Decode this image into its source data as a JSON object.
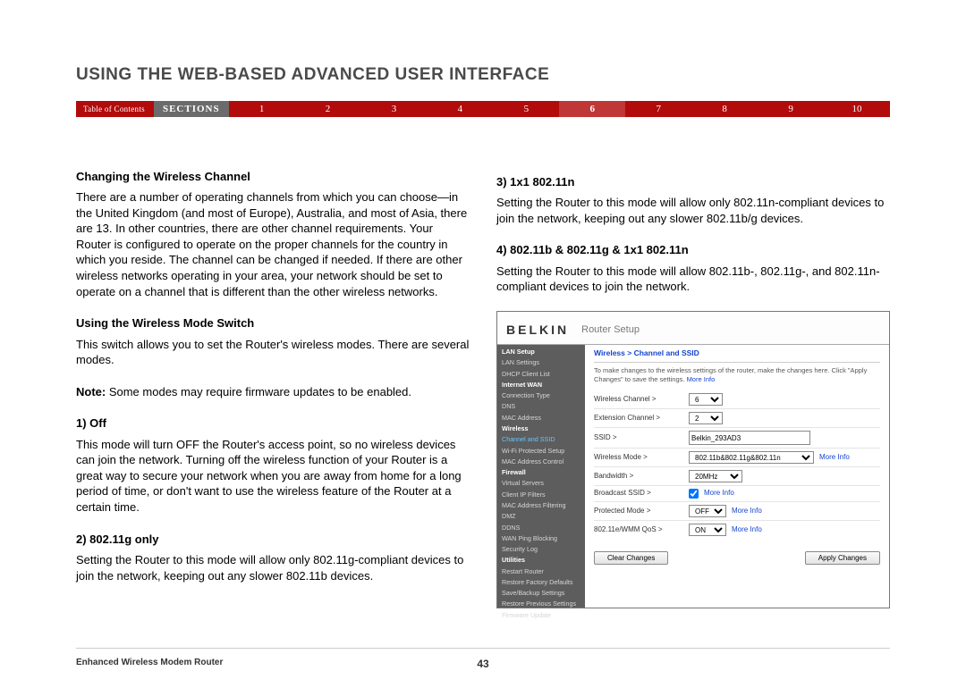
{
  "title": "USING THE WEB-BASED ADVANCED USER INTERFACE",
  "nav": {
    "toc": "Table of Contents",
    "sections": "SECTIONS",
    "nums": [
      "1",
      "2",
      "3",
      "4",
      "5",
      "6",
      "7",
      "8",
      "9",
      "10"
    ],
    "active": "6"
  },
  "left": {
    "h1": "Changing the Wireless Channel",
    "p1": "There are a number of operating channels from which you can choose—in the United Kingdom (and most of Europe), Australia, and most of Asia, there are 13. In other countries, there are other channel requirements. Your Router is configured to operate on the proper channels for the country in which you reside. The channel can be changed if needed. If there are other wireless networks operating in your area, your network should be set to operate on a channel that is different than the other wireless networks.",
    "h2": "Using the Wireless Mode Switch",
    "p2": "This switch allows you to set the Router's wireless modes. There are several modes.",
    "note_label": "Note:",
    "note_text": " Some modes may require firmware updates to be enabled.",
    "m1h": "1) Off",
    "m1p": "This mode will turn OFF the Router's access point, so no wireless devices can join the network. Turning off the wireless function of your Router is a great way to secure your network when you are away from home for a long period of time, or don't want to use the wireless feature of the Router at a certain time.",
    "m2h": "2) 802.11g only",
    "m2p": "Setting the Router to this mode will allow only 802.11g-compliant devices to join the network, keeping out any slower 802.11b devices."
  },
  "right": {
    "m3h": "3) 1x1 802.11n",
    "m3p": "Setting the Router to this mode will allow only 802.11n-compliant devices to join the network, keeping out any slower 802.11b/g devices.",
    "m4h": "4) 802.11b & 802.11g & 1x1 802.11n",
    "m4p": "Setting the Router to this mode will allow 802.11b-, 802.11g-, and 802.11n-compliant devices to join the network."
  },
  "router": {
    "brand": "BELKIN",
    "setup": "Router Setup",
    "breadcrumb": "Wireless > Channel and SSID",
    "note_text": "To make changes to the wireless settings of the router, make the changes here. Click \"Apply Changes\" to save the settings. ",
    "more_info": "More Info",
    "rows": {
      "ch_l": "Wireless Channel >",
      "ch_v": "6",
      "ex_l": "Extension Channel >",
      "ex_v": "2",
      "ss_l": "SSID >",
      "ss_v": "Belkin_293AD3",
      "wm_l": "Wireless Mode >",
      "wm_v": "802.11b&802.11g&802.11n",
      "bw_l": "Bandwidth >",
      "bw_v": "20MHz",
      "bs_l": "Broadcast SSID >",
      "pm_l": "Protected Mode >",
      "pm_v": "OFF",
      "qos_l": "802.11e/WMM QoS >",
      "qos_v": "ON"
    },
    "btn_clear": "Clear Changes",
    "btn_apply": "Apply Changes",
    "sidebar": [
      {
        "t": "LAN Setup",
        "c": "side-head"
      },
      {
        "t": "LAN Settings"
      },
      {
        "t": "DHCP Client List"
      },
      {
        "t": "Internet WAN",
        "c": "side-head"
      },
      {
        "t": "Connection Type"
      },
      {
        "t": "DNS"
      },
      {
        "t": "MAC Address"
      },
      {
        "t": "Wireless",
        "c": "side-head"
      },
      {
        "t": "Channel and SSID",
        "c": "side-active"
      },
      {
        "t": "Wi-Fi Protected Setup"
      },
      {
        "t": "MAC Address Control"
      },
      {
        "t": "Firewall",
        "c": "side-head"
      },
      {
        "t": "Virtual Servers"
      },
      {
        "t": "Client IP Filters"
      },
      {
        "t": "MAC Address Filtering"
      },
      {
        "t": "DMZ"
      },
      {
        "t": "DDNS"
      },
      {
        "t": "WAN Ping Blocking"
      },
      {
        "t": "Security Log"
      },
      {
        "t": "Utilities",
        "c": "side-head"
      },
      {
        "t": "Restart Router"
      },
      {
        "t": "Restore Factory Defaults"
      },
      {
        "t": "Save/Backup Settings"
      },
      {
        "t": "Restore Previous Settings"
      },
      {
        "t": "Firmware Update"
      }
    ]
  },
  "footer": {
    "product": "Enhanced Wireless Modem Router",
    "page": "43"
  }
}
